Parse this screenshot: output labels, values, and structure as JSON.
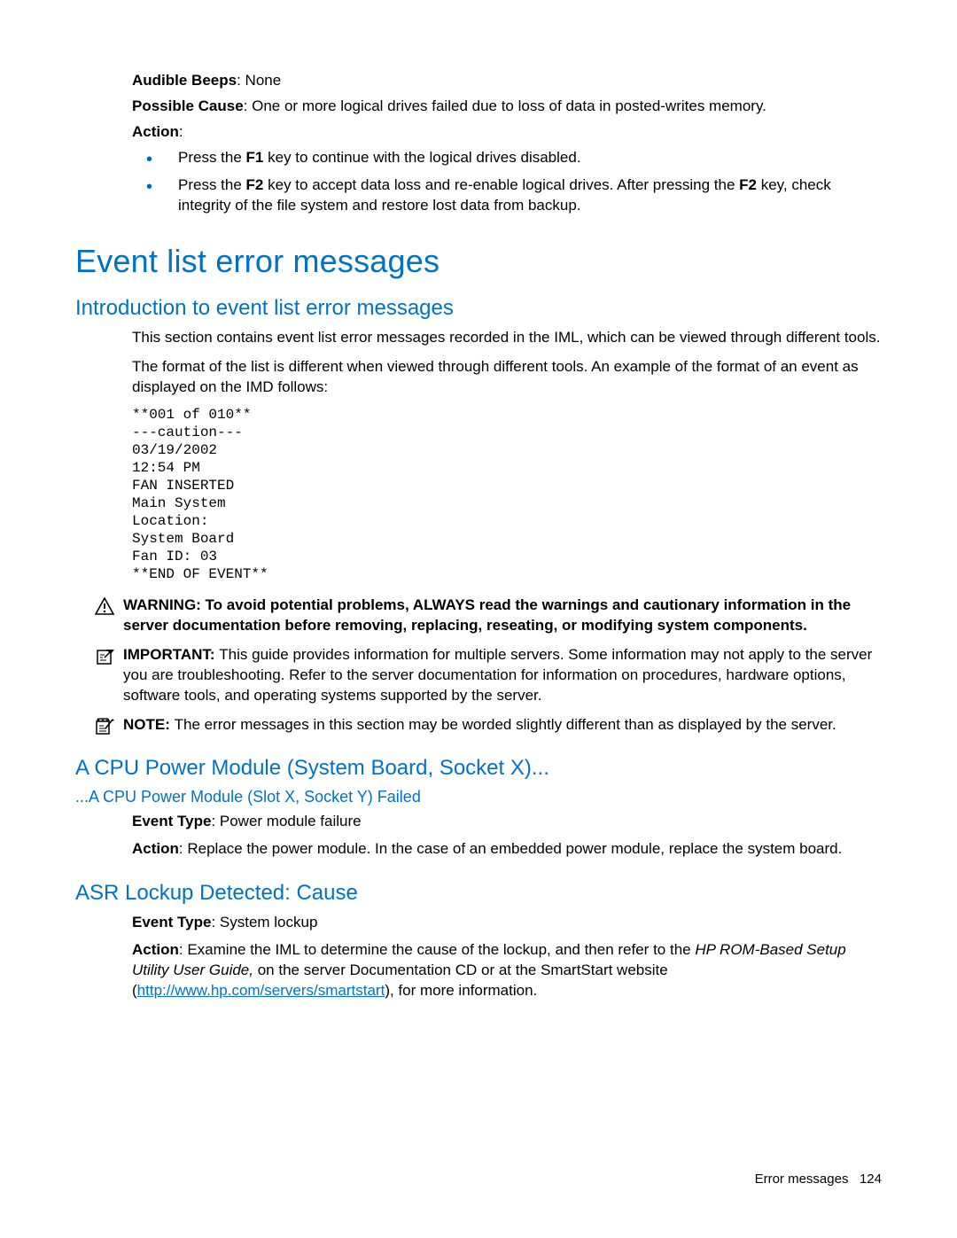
{
  "top": {
    "audible_beeps_label": "Audible Beeps",
    "audible_beeps_value": ": None",
    "possible_cause_label": "Possible Cause",
    "possible_cause_value": ": One or more logical drives failed due to loss of data in posted-writes memory.",
    "action_label": "Action",
    "action_colon": ":",
    "bullet1_a": "Press the ",
    "bullet1_key": "F1",
    "bullet1_b": " key to continue with the logical drives disabled.",
    "bullet2_a": "Press the ",
    "bullet2_key1": "F2",
    "bullet2_b": " key to accept data loss and re-enable logical drives. After pressing the ",
    "bullet2_key2": "F2",
    "bullet2_c": " key, check integrity of the file system and restore lost data from backup."
  },
  "h1": "Event list error messages",
  "intro": {
    "heading": "Introduction to event list error messages",
    "p1": "This section contains event list error messages recorded in the IML, which can be viewed through different tools.",
    "p2": "The format of the list is different when viewed through different tools. An example of the format of an event as displayed on the IMD follows:",
    "pre": "**001 of 010**\n---caution---\n03/19/2002\n12:54 PM\nFAN INSERTED\nMain System\nLocation:\nSystem Board\nFan ID: 03\n**END OF EVENT**"
  },
  "warning": {
    "label": "WARNING:  ",
    "text": "To avoid potential problems, ALWAYS read the warnings and cautionary information in the server documentation before removing, replacing, reseating, or modifying system components."
  },
  "important": {
    "label": "IMPORTANT:  ",
    "text": "This guide provides information for multiple servers. Some information may not apply to the server you are troubleshooting. Refer to the server documentation for information on procedures, hardware options, software tools, and operating systems supported by the server."
  },
  "note": {
    "label": "NOTE:  ",
    "text": "The error messages in this section may be worded slightly different than as displayed by the server."
  },
  "cpu": {
    "heading": "A CPU Power Module (System Board, Socket X)...",
    "sub": "...A CPU Power Module (Slot X, Socket Y) Failed",
    "event_type_label": "Event Type",
    "event_type_value": ": Power module failure",
    "action_label": "Action",
    "action_value": ": Replace the power module. In the case of an embedded power module, replace the system board."
  },
  "asr": {
    "heading": "ASR Lockup Detected: Cause",
    "event_type_label": "Event Type",
    "event_type_value": ": System lockup",
    "action_label": "Action",
    "action_a": ": Examine the IML to determine the cause of the lockup, and then refer to the ",
    "action_italic": "HP ROM-Based Setup Utility User Guide,",
    "action_b": " on the server Documentation CD or at the SmartStart website (",
    "link_text": "http://www.hp.com/servers/smartstart",
    "link_href": "http://www.hp.com/servers/smartstart",
    "action_c": "), for more information."
  },
  "footer": {
    "text": "Error messages",
    "page": "124"
  }
}
